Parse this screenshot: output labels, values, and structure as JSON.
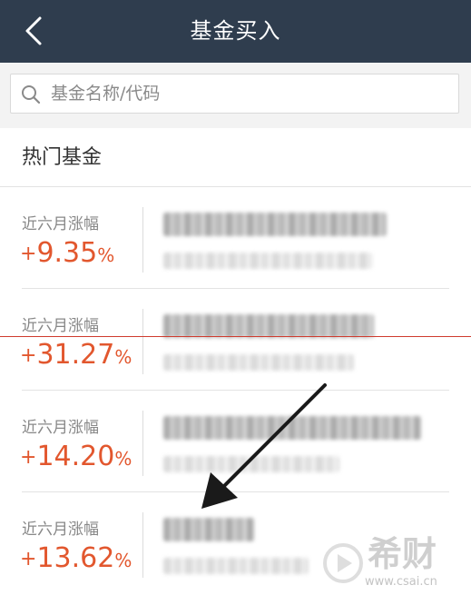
{
  "header": {
    "title": "基金买入",
    "back_icon": "chevron-left-icon",
    "background_color": "#2f3d4e"
  },
  "search": {
    "placeholder": "基金名称/代码",
    "value": "",
    "icon": "search-icon"
  },
  "section": {
    "title": "热门基金"
  },
  "funds": [
    {
      "growth_label": "近六月涨幅",
      "sign": "+",
      "value": "9.35",
      "unit": "%"
    },
    {
      "growth_label": "近六月涨幅",
      "sign": "+",
      "value": "31.27",
      "unit": "%"
    },
    {
      "growth_label": "近六月涨幅",
      "sign": "+",
      "value": "14.20",
      "unit": "%"
    },
    {
      "growth_label": "近六月涨幅",
      "sign": "+",
      "value": "13.62",
      "unit": "%"
    }
  ],
  "watermark": {
    "brand": "希财",
    "url": "www.csai.cn"
  },
  "colors": {
    "accent_red": "#e2572e",
    "annotation_line": "#cf3b2e"
  }
}
